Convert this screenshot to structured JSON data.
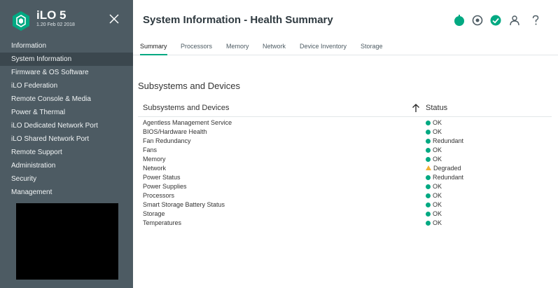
{
  "app": {
    "name": "iLO 5",
    "version": "1.20 Feb 02 2018"
  },
  "sidebar": {
    "items": [
      {
        "label": "Information",
        "active": false
      },
      {
        "label": "System Information",
        "active": true
      },
      {
        "label": "Firmware & OS Software",
        "active": false
      },
      {
        "label": "iLO Federation",
        "active": false
      },
      {
        "label": "Remote Console & Media",
        "active": false
      },
      {
        "label": "Power & Thermal",
        "active": false
      },
      {
        "label": "iLO Dedicated Network Port",
        "active": false
      },
      {
        "label": "iLO Shared Network Port",
        "active": false
      },
      {
        "label": "Remote Support",
        "active": false
      },
      {
        "label": "Administration",
        "active": false
      },
      {
        "label": "Security",
        "active": false
      },
      {
        "label": "Management",
        "active": false
      }
    ]
  },
  "header": {
    "title": "System Information - Health Summary",
    "icons": [
      "power-icon",
      "ufo-indicator-icon",
      "health-ok-icon",
      "user-icon",
      "help-icon"
    ]
  },
  "tabs": [
    {
      "label": "Summary",
      "active": true
    },
    {
      "label": "Processors",
      "active": false
    },
    {
      "label": "Memory",
      "active": false
    },
    {
      "label": "Network",
      "active": false
    },
    {
      "label": "Device Inventory",
      "active": false
    },
    {
      "label": "Storage",
      "active": false
    }
  ],
  "section": {
    "title": "Subsystems and Devices"
  },
  "table": {
    "columns": [
      "Subsystems and Devices",
      "Status"
    ],
    "rows": [
      {
        "name": "Agentless Management Service",
        "status": "OK",
        "state": "ok"
      },
      {
        "name": "BIOS/Hardware Health",
        "status": "OK",
        "state": "ok"
      },
      {
        "name": "Fan Redundancy",
        "status": "Redundant",
        "state": "ok"
      },
      {
        "name": "Fans",
        "status": "OK",
        "state": "ok"
      },
      {
        "name": "Memory",
        "status": "OK",
        "state": "ok"
      },
      {
        "name": "Network",
        "status": "Degraded",
        "state": "warning"
      },
      {
        "name": "Power Status",
        "status": "Redundant",
        "state": "ok"
      },
      {
        "name": "Power Supplies",
        "status": "OK",
        "state": "ok"
      },
      {
        "name": "Processors",
        "status": "OK",
        "state": "ok"
      },
      {
        "name": "Smart Storage Battery Status",
        "status": "OK",
        "state": "ok"
      },
      {
        "name": "Storage",
        "status": "OK",
        "state": "ok"
      },
      {
        "name": "Temperatures",
        "status": "OK",
        "state": "ok"
      }
    ]
  },
  "colors": {
    "sidebar_bg": "#4d5b63",
    "active_bg": "#3b474e",
    "accent_green": "#01a982",
    "warning_amber": "#f2b134"
  }
}
